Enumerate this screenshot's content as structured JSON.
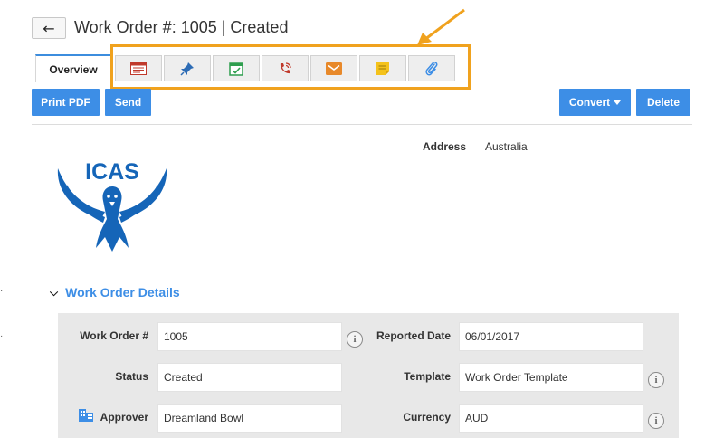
{
  "header": {
    "back_icon": "back-arrow-icon",
    "title": "Work Order #: 1005 | Created"
  },
  "tabs": {
    "overview_label": "Overview",
    "icon_tabs": [
      "summary-icon",
      "pin-icon",
      "calendar-check-icon",
      "phone-icon",
      "mail-icon",
      "note-icon",
      "attachment-icon"
    ]
  },
  "actions": {
    "print_pdf": "Print PDF",
    "send": "Send",
    "convert": "Convert",
    "delete": "Delete"
  },
  "address": {
    "label": "Address",
    "value": "Australia"
  },
  "logo": {
    "text": "ICAS"
  },
  "section": {
    "title": "Work Order Details"
  },
  "fields": {
    "work_order_label": "Work Order #",
    "work_order_value": "1005",
    "reported_date_label": "Reported Date",
    "reported_date_value": "06/01/2017",
    "status_label": "Status",
    "status_value": "Created",
    "template_label": "Template",
    "template_value": "Work Order Template",
    "approver_label": "Approver",
    "approver_value": "Dreamland Bowl",
    "currency_label": "Currency",
    "currency_value": "AUD",
    "info_glyph": "i"
  },
  "colors": {
    "accent": "#3d8ee6",
    "highlight": "#f0a21e",
    "logo_blue": "#1565b8"
  }
}
